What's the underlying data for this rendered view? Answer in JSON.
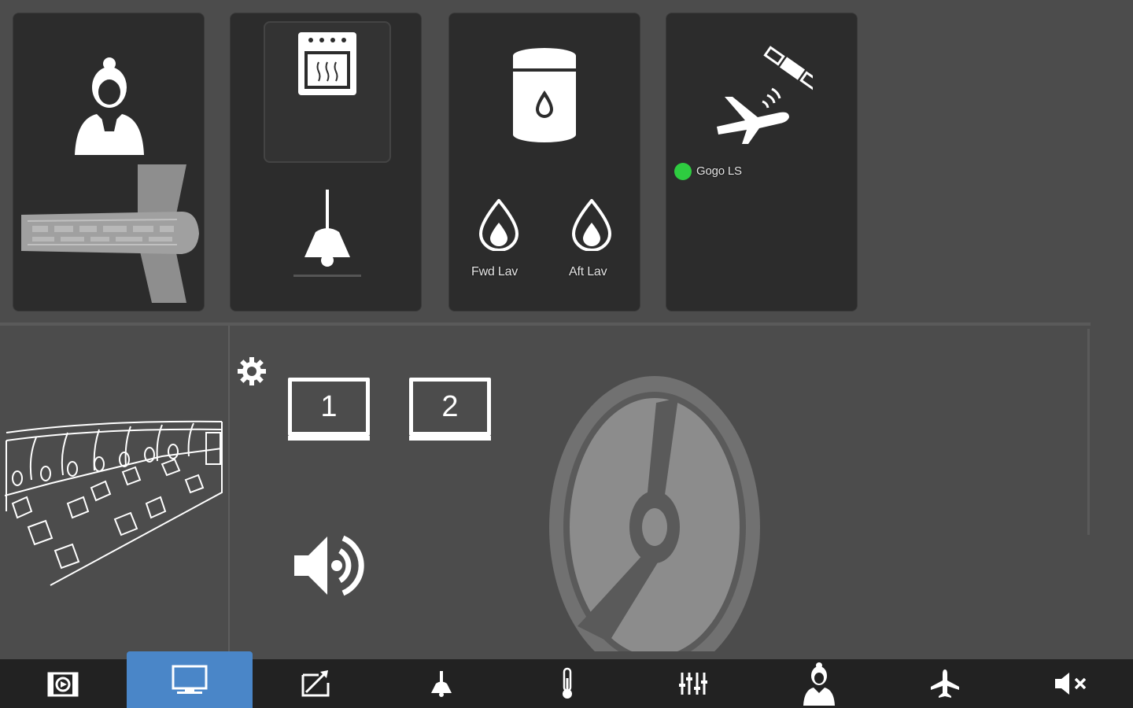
{
  "tiles": {
    "water": {
      "fwd_label": "Fwd Lav",
      "aft_label": "Aft Lav"
    },
    "connectivity": {
      "status_label": "Gogo LS",
      "status_color": "#2ecc40"
    }
  },
  "media": {
    "monitors": [
      {
        "label": "1"
      },
      {
        "label": "2"
      }
    ]
  },
  "bottom_nav": {
    "items": [
      {
        "icon": "media-icon"
      },
      {
        "icon": "monitor-icon",
        "active": true
      },
      {
        "icon": "moving-map-icon"
      },
      {
        "icon": "light-icon"
      },
      {
        "icon": "thermometer-icon"
      },
      {
        "icon": "mixer-icon"
      },
      {
        "icon": "attendant-icon"
      },
      {
        "icon": "airplane-icon"
      },
      {
        "icon": "mute-icon"
      }
    ]
  },
  "colors": {
    "background": "#4c4c4c",
    "tile": "#2c2c2c",
    "accent": "#4a86c8",
    "status_ok": "#2ecc40"
  }
}
